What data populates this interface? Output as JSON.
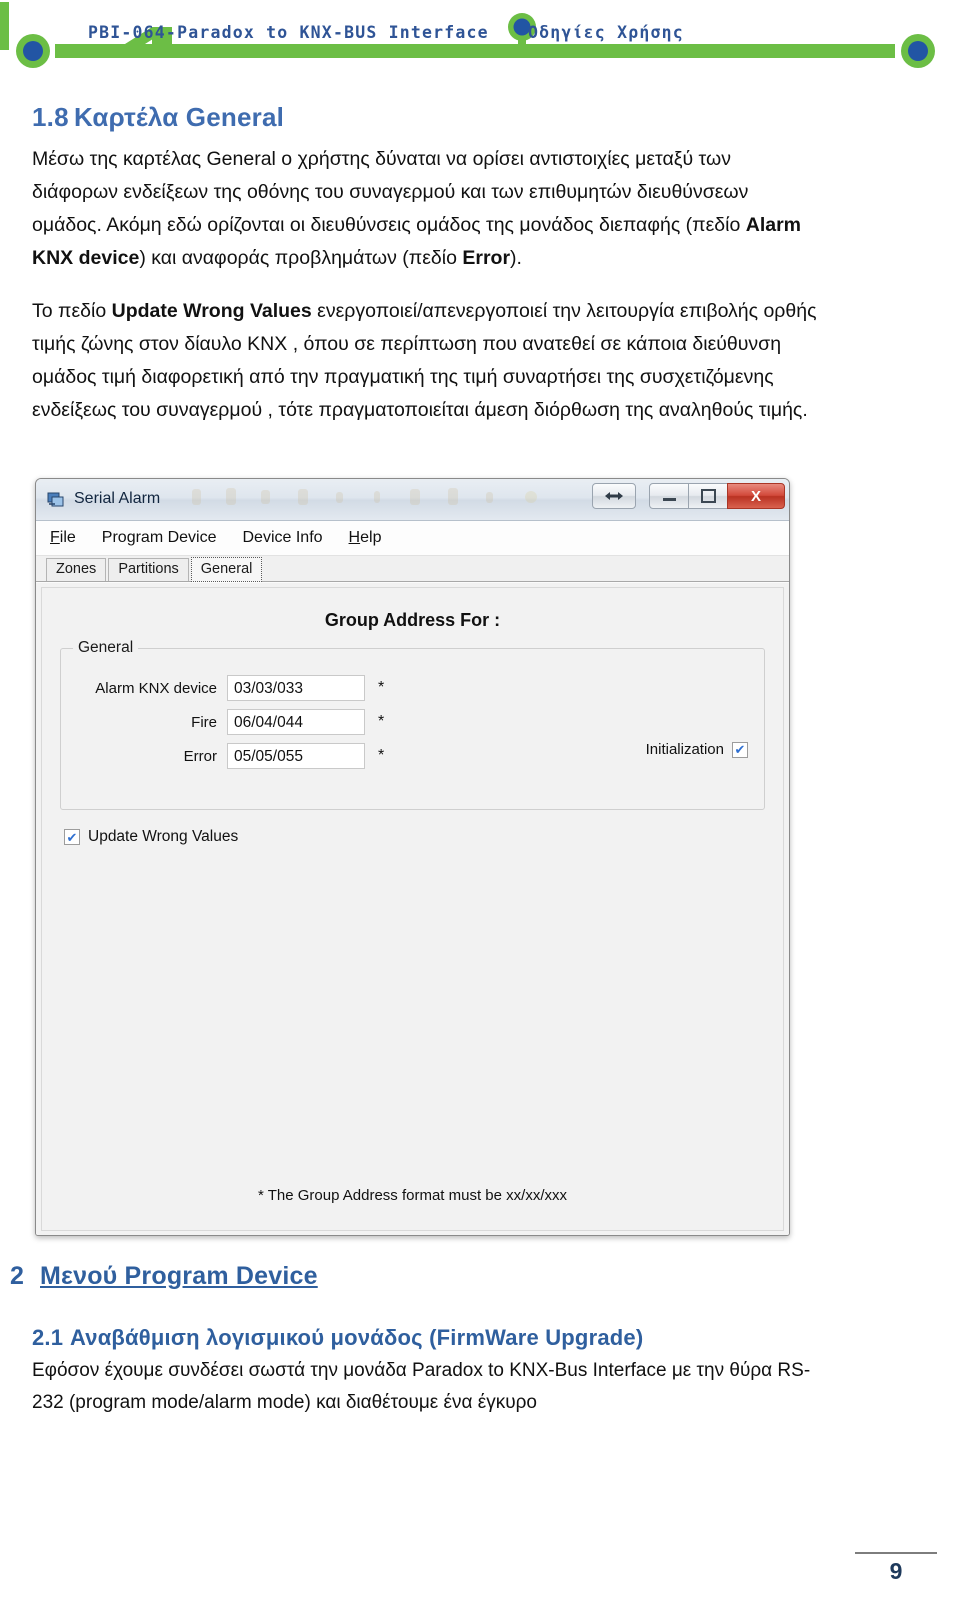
{
  "header": {
    "title": "PBI-064-Paradox to KNX-BUS Interface",
    "subtitle": "Οδηγίες Χρήσης",
    "accent_green": "#6cbe45",
    "accent_blue": "#2255a4",
    "text_color": "#2f5496"
  },
  "section": {
    "number": "1.8",
    "heading": "Καρτέλα General",
    "paragraph1": "Μέσω της καρτέλας General ο χρήστης δύναται να ορίσει αντιστοιχίες μεταξύ των διάφορων ενδείξεων της οθόνης του συναγερμού  και των επιθυμητών διευθύνσεων ομάδος.  Ακόμη εδώ ορίζονται οι διευθύνσεις ομάδος της μονάδος διεπαφής (πεδίο ",
    "paragraph1_b1": "Alarm KNX device",
    "paragraph1_mid": ") και αναφοράς προβλημάτων (πεδίο ",
    "paragraph1_b2": "Error",
    "paragraph1_end": ").",
    "paragraph2_start": "Το πεδίο ",
    "paragraph2_b1": "Update Wrong Values",
    "paragraph2_end": " ενεργοποιεί/απενεργοποιεί την λειτουργία επιβολής ορθής τιμής ζώνης στον δίαυλο KNX , όπου σε περίπτωση που ανατεθεί σε κάποια διεύθυνση ομάδος τιμή διαφορετική από την πραγματική της τιμή συναρτήσει της συσχετιζόμενης ενδείξεως του συναγερμού , τότε πραγματοποιείται άμεση διόρθωση της αναληθούς τιμής."
  },
  "app": {
    "title": "Serial Alarm",
    "window_buttons": {
      "resize": "⇔",
      "minimize": "minimize",
      "maximize": "maximize",
      "close": "X"
    },
    "menu": [
      {
        "label": "File",
        "accel": "F"
      },
      {
        "label": "Program Device",
        "accel": ""
      },
      {
        "label": "Device Info",
        "accel": ""
      },
      {
        "label": "Help",
        "accel": "H"
      }
    ],
    "tabs": [
      {
        "label": "Zones",
        "active": false
      },
      {
        "label": "Partitions",
        "active": false
      },
      {
        "label": "General",
        "active": true
      }
    ],
    "group_title": "Group Address For :",
    "fieldset_legend": "General",
    "fields": [
      {
        "label": "Alarm KNX device",
        "value": "03/03/033",
        "marker": "*"
      },
      {
        "label": "Fire",
        "value": "06/04/044",
        "marker": "*"
      },
      {
        "label": "Error",
        "value": "05/05/055",
        "marker": "*"
      }
    ],
    "initialization": {
      "label": "Initialization",
      "checked": true,
      "mark": "✔"
    },
    "update_wrong_values": {
      "label": "Update Wrong Values",
      "checked": true,
      "mark": "✔"
    },
    "footnote": "* The Group Address format must be xx/xx/xxx"
  },
  "section2": {
    "number": "2",
    "heading": "Μενού Program Device",
    "sub_number": "2.1",
    "sub_heading": "Αναβάθμιση λογισμικού μονάδος (FirmWare Upgrade)",
    "paragraph": "Εφόσον  έχουμε συνδέσει σωστά την μονάδα Paradox to KNX-Bus Interface με την  θύρα  RS-232  (program mode/alarm mode) και διαθέτουμε ένα έγκυρο"
  },
  "footer": {
    "page_number": "9"
  }
}
